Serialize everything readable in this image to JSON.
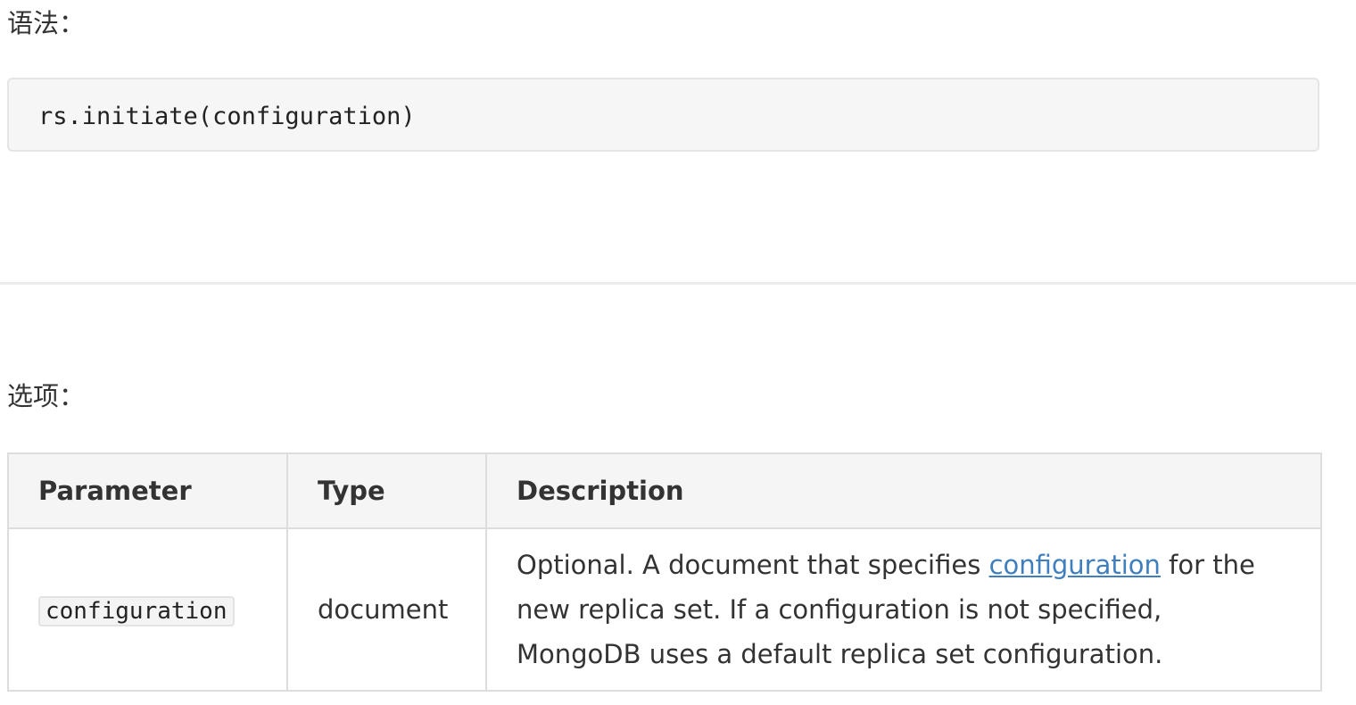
{
  "syntax": {
    "heading": "语法：",
    "code": "rs.initiate(configuration)"
  },
  "options": {
    "heading": "选项：",
    "table": {
      "headers": [
        "Parameter",
        "Type",
        "Description"
      ],
      "rows": [
        {
          "parameter": "configuration",
          "type": "document",
          "description_before": "Optional. A document that specifies ",
          "description_link": "configuration",
          "description_after": " for the new replica set. If a configuration is not specified, MongoDB uses a default replica set configuration."
        }
      ]
    }
  },
  "colors": {
    "link": "#3f7fbf",
    "text": "#333333",
    "code_background": "#f6f6f6",
    "table_header_background": "#f5f5f5"
  }
}
